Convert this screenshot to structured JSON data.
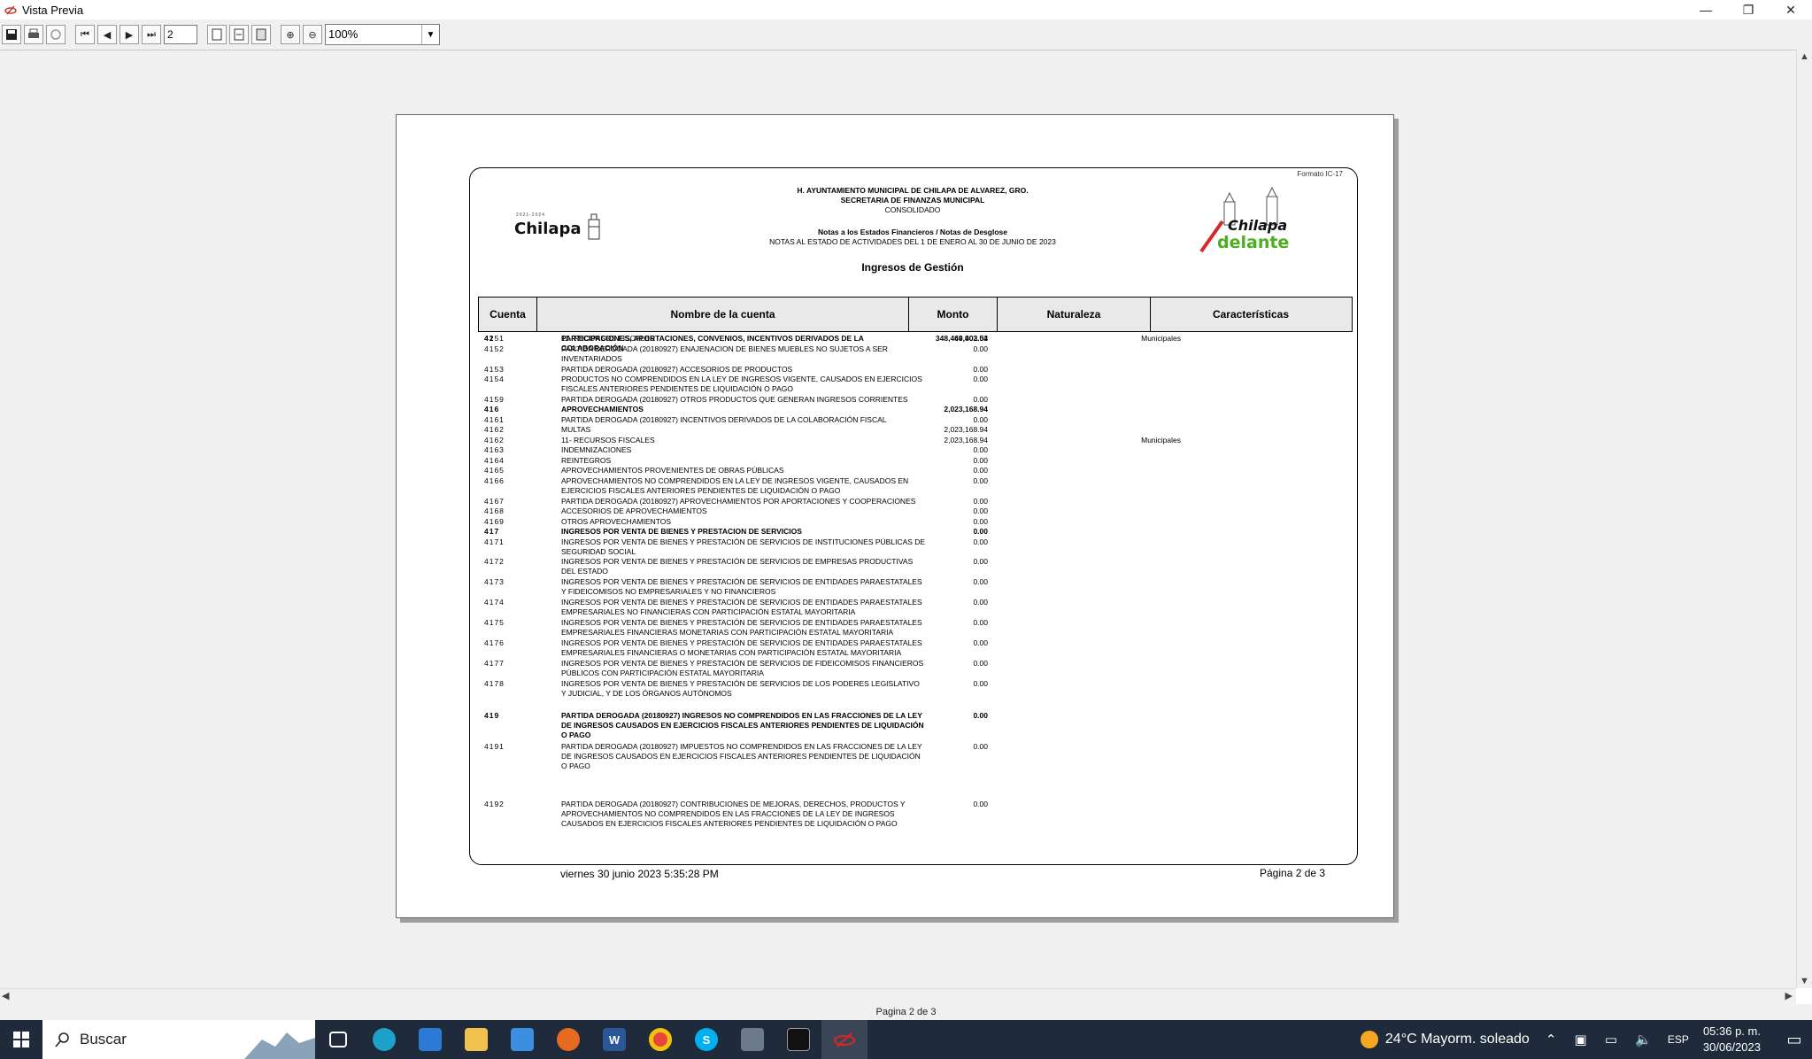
{
  "window": {
    "title": "Vista Previa",
    "minimize": "—",
    "restore": "❐",
    "close": "✕"
  },
  "toolbar": {
    "page_value": "2",
    "zoom_value": "100%"
  },
  "report": {
    "formato": "Formato IC-17",
    "logo_left_text": "Chilapa",
    "logo_left_small": "2021-2024",
    "logo_right_text_1": "Chilapa",
    "logo_right_text_2": "delante",
    "header_line1": "H. AYUNTAMIENTO MUNICIPAL DE CHILAPA DE ALVAREZ, GRO.",
    "header_line2": "SECRETARIA DE FINANZAS MUNICIPAL",
    "header_line3": "CONSOLIDADO",
    "header_line4": "Notas a los Estados Financieros / Notas de Desglose",
    "header_line5": "NOTAS AL ESTADO DE ACTIVIDADES DEL 1 DE ENERO AL 30 DE JUNIO DE 2023",
    "section_title": "Ingresos de Gestión",
    "columns": [
      "Cuenta",
      "Nombre de la cuenta",
      "Monto",
      "Naturaleza",
      "Características"
    ],
    "rows": [
      {
        "cuenta": "4151",
        "nombre": "11- RECURSOS FISCALES",
        "monto": "44,903.02",
        "nat": "Municipales",
        "bold": false
      },
      {
        "cuenta": "4152",
        "nombre": "PARTIDA DEROGADA (20180927) ENAJENACION DE BIENES MUEBLES NO SUJETOS A SER INVENTARIADOS",
        "monto": "0.00",
        "nat": "",
        "bold": false
      },
      {
        "cuenta": "4153",
        "nombre": "PARTIDA DEROGADA (20180927) ACCESORIOS DE PRODUCTOS",
        "monto": "0.00",
        "nat": "",
        "bold": false
      },
      {
        "cuenta": "4154",
        "nombre": "PRODUCTOS NO COMPRENDIDOS EN LA LEY DE INGRESOS VIGENTE, CAUSADOS EN EJERCICIOS FISCALES ANTERIORES PENDIENTES DE LIQUIDACIÓN O PAGO",
        "monto": "0.00",
        "nat": "",
        "bold": false
      },
      {
        "cuenta": "4159",
        "nombre": "PARTIDA DEROGADA (20180927) OTROS PRODUCTOS QUE GENERAN INGRESOS CORRIENTES",
        "monto": "0.00",
        "nat": "",
        "bold": false
      },
      {
        "cuenta": "416",
        "nombre": "APROVECHAMIENTOS",
        "monto": "2,023,168.94",
        "nat": "",
        "bold": true
      },
      {
        "cuenta": "4161",
        "nombre": "PARTIDA DEROGADA (20180927) INCENTIVOS DERIVADOS DE LA COLABORACIÓN FISCAL",
        "monto": "0.00",
        "nat": "",
        "bold": false
      },
      {
        "cuenta": "4162",
        "nombre": "MULTAS",
        "monto": "2,023,168.94",
        "nat": "",
        "bold": false
      },
      {
        "cuenta": "4162",
        "nombre": "11- RECURSOS FISCALES",
        "monto": "2,023,168.94",
        "nat": "Municipales",
        "bold": false
      },
      {
        "cuenta": "4163",
        "nombre": "INDEMNIZACIONES",
        "monto": "0.00",
        "nat": "",
        "bold": false
      },
      {
        "cuenta": "4164",
        "nombre": "REINTEGROS",
        "monto": "0.00",
        "nat": "",
        "bold": false
      },
      {
        "cuenta": "4165",
        "nombre": "APROVECHAMIENTOS PROVENIENTES DE OBRAS PÚBLICAS",
        "monto": "0.00",
        "nat": "",
        "bold": false
      },
      {
        "cuenta": "4166",
        "nombre": "APROVECHAMIENTOS NO COMPRENDIDOS EN LA LEY DE INGRESOS VIGENTE, CAUSADOS EN EJERCICIOS FISCALES ANTERIORES PENDIENTES DE LIQUIDACIÓN O PAGO",
        "monto": "0.00",
        "nat": "",
        "bold": false
      },
      {
        "cuenta": "4167",
        "nombre": "PARTIDA DEROGADA (20180927) APROVECHAMIENTOS POR APORTACIONES Y COOPERACIONES",
        "monto": "0.00",
        "nat": "",
        "bold": false
      },
      {
        "cuenta": "4168",
        "nombre": "ACCESORIOS DE APROVECHAMIENTOS",
        "monto": "0.00",
        "nat": "",
        "bold": false
      },
      {
        "cuenta": "4169",
        "nombre": "OTROS APROVECHAMIENTOS",
        "monto": "0.00",
        "nat": "",
        "bold": false
      },
      {
        "cuenta": "417",
        "nombre": "INGRESOS POR VENTA DE BIENES Y PRESTACION DE SERVICIOS",
        "monto": "0.00",
        "nat": "",
        "bold": true
      },
      {
        "cuenta": "4171",
        "nombre": "INGRESOS POR VENTA DE BIENES Y PRESTACIÓN DE SERVICIOS DE INSTITUCIONES PÚBLICAS DE SEGURIDAD SOCIAL",
        "monto": "0.00",
        "nat": "",
        "bold": false
      },
      {
        "cuenta": "4172",
        "nombre": "INGRESOS POR VENTA DE BIENES Y PRESTACIÓN DE SERVICIOS DE EMPRESAS PRODUCTIVAS DEL ESTADO",
        "monto": "0.00",
        "nat": "",
        "bold": false
      },
      {
        "cuenta": "4173",
        "nombre": "INGRESOS POR VENTA DE BIENES Y PRESTACIÓN DE SERVICIOS DE ENTIDADES PARAESTATALES Y FIDEICOMISOS NO EMPRESARIALES Y NO FINANCIEROS",
        "monto": "0.00",
        "nat": "",
        "bold": false
      },
      {
        "cuenta": "4174",
        "nombre": "INGRESOS POR VENTA DE BIENES Y PRESTACIÓN DE SERVICIOS DE ENTIDADES PARAESTATALES EMPRESARIALES NO FINANCIERAS CON PARTICIPACIÓN ESTATAL MAYORITARIA",
        "monto": "0.00",
        "nat": "",
        "bold": false
      },
      {
        "cuenta": "4175",
        "nombre": "INGRESOS POR VENTA DE BIENES Y PRESTACIÓN DE SERVICIOS DE ENTIDADES PARAESTATALES EMPRESARIALES FINANCIERAS MONETARIAS CON PARTICIPACIÓN ESTATAL MAYORITARIA",
        "monto": "0.00",
        "nat": "",
        "bold": false
      },
      {
        "cuenta": "4176",
        "nombre": "INGRESOS POR VENTA DE BIENES Y PRESTACIÓN DE SERVICIOS DE ENTIDADES PARAESTATALES EMPRESARIALES FINANCIERAS O MONETARIAS CON PARTICIPACIÓN ESTATAL MAYORITARIA",
        "monto": "0.00",
        "nat": "",
        "bold": false
      },
      {
        "cuenta": "4177",
        "nombre": "INGRESOS POR VENTA DE BIENES Y PRESTACIÓN DE SERVICIOS DE FIDEICOMISOS FINANCIEROS PÚBLICOS CON PARTICIPACIÓN ESTATAL MAYORITARIA",
        "monto": "0.00",
        "nat": "",
        "bold": false
      },
      {
        "cuenta": "4178",
        "nombre": "INGRESOS POR VENTA DE BIENES Y PRESTACIÓN DE SERVICIOS DE LOS PODERES LEGISLATIVO Y JUDICIAL, Y DE LOS ÓRGANOS AUTÓNOMOS",
        "monto": "0.00",
        "nat": "",
        "bold": false
      },
      {
        "cuenta": "419",
        "nombre": "PARTIDA DEROGADA (20180927) INGRESOS NO COMPRENDIDOS EN LAS FRACCIONES DE LA LEY DE INGRESOS CAUSADOS EN EJERCICIOS FISCALES ANTERIORES PENDIENTES DE LIQUIDACIÓN O PAGO",
        "monto": "0.00",
        "nat": "",
        "bold": true
      },
      {
        "cuenta": "4191",
        "nombre": "PARTIDA DEROGADA (20180927) IMPUESTOS NO COMPRENDIDOS EN LAS FRACCIONES DE LA LEY DE INGRESOS CAUSADOS EN EJERCICIOS FISCALES ANTERIORES PENDIENTES DE LIQUIDACIÓN O PAGO",
        "monto": "0.00",
        "nat": "",
        "bold": false
      },
      {
        "cuenta": "4192",
        "nombre": "PARTIDA DEROGADA (20180927) CONTRIBUCIONES DE MEJORAS, DERECHOS, PRODUCTOS Y APROVECHAMIENTOS NO COMPRENDIDOS EN LAS FRACCIONES DE LA LEY DE INGRESOS CAUSADOS EN EJERCICIOS FISCALES ANTERIORES PENDIENTES DE LIQUIDACIÓN O PAGO",
        "monto": "0.00",
        "nat": "",
        "bold": false
      },
      {
        "cuenta": "42",
        "nombre": "PARTICIPACIONES, APORTACIONES, CONVENIOS, INCENTIVOS DERIVADOS DE LA COLABORACIÓN",
        "monto": "348,469,402.54",
        "nat": "",
        "bold": true
      }
    ],
    "footer_date": "viernes 30 junio 2023 5:35:28 PM",
    "footer_page": "Página 2 de 3"
  },
  "status": {
    "page_text": "Pagina 2 de 3"
  },
  "taskbar": {
    "search_label": "Buscar",
    "weather": "24°C  Mayorm. soleado",
    "lang": "ESP",
    "time": "05:36 p. m.",
    "date": "30/06/2023"
  }
}
